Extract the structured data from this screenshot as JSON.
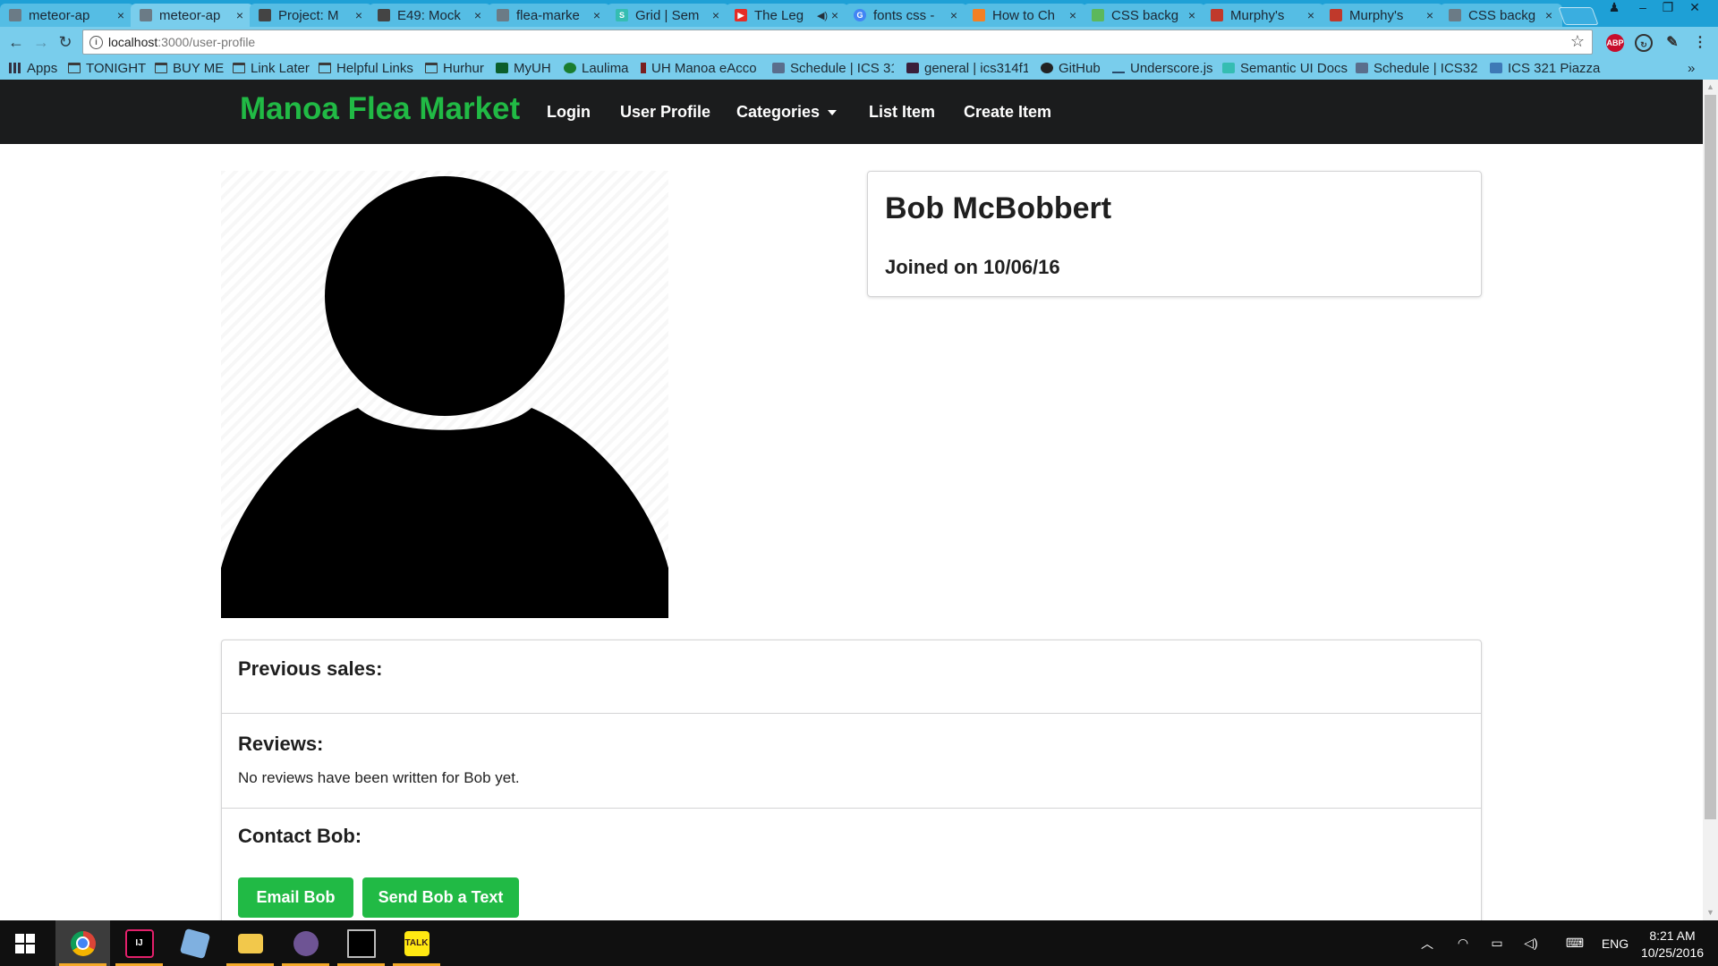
{
  "browser": {
    "tabs": [
      {
        "title": "meteor-ap",
        "favicon": "page-icon",
        "color": "#6b7b86",
        "active": false
      },
      {
        "title": "meteor-ap",
        "favicon": "page-icon",
        "color": "#6b7b86",
        "active": true
      },
      {
        "title": "Project: M",
        "favicon": "github-icon",
        "color": "#444444",
        "active": false
      },
      {
        "title": "E49: Mock",
        "favicon": "github-icon",
        "color": "#444444",
        "active": false
      },
      {
        "title": "flea-marke",
        "favicon": "page-icon",
        "color": "#6b7b86",
        "active": false
      },
      {
        "title": "Grid | Sem",
        "favicon": "semantic-ui-icon",
        "color": "#35bdb2",
        "active": false
      },
      {
        "title": "The Leg",
        "favicon": "youtube-icon",
        "color": "#e52d27",
        "active": false,
        "audio": true
      },
      {
        "title": "fonts css -",
        "favicon": "google-icon",
        "color": "#4285f4",
        "active": false
      },
      {
        "title": "How to Ch",
        "favicon": "stackoverflow-icon",
        "color": "#f48024",
        "active": false
      },
      {
        "title": "CSS backg",
        "favicon": "w3schools-icon",
        "color": "#5cb85c",
        "active": false
      },
      {
        "title": "Murphy's",
        "favicon": "murphys-icon",
        "color": "#c0392b",
        "active": false
      },
      {
        "title": "Murphy's",
        "favicon": "murphys-icon",
        "color": "#c0392b",
        "active": false
      },
      {
        "title": "CSS backg",
        "favicon": "page-icon",
        "color": "#6b7b86",
        "active": false
      }
    ],
    "url_host": "localhost",
    "url_path": ":3000/user-profile",
    "bookmarks": [
      {
        "label": "Apps",
        "icon": "apps-grid-icon"
      },
      {
        "label": "TONIGHT",
        "icon": "folder-icon"
      },
      {
        "label": "BUY ME",
        "icon": "folder-icon"
      },
      {
        "label": "Link Later",
        "icon": "folder-icon"
      },
      {
        "label": "Helpful Links",
        "icon": "folder-icon"
      },
      {
        "label": "Hurhur",
        "icon": "folder-icon"
      },
      {
        "label": "MyUH",
        "icon": "myuh-icon"
      },
      {
        "label": "Laulima",
        "icon": "laulima-icon"
      },
      {
        "label": "UH Manoa eAcco",
        "icon": "uh-icon"
      },
      {
        "label": "Schedule | ICS 31",
        "icon": "page-icon"
      },
      {
        "label": "general | ics314f1",
        "icon": "slack-icon"
      },
      {
        "label": "GitHub",
        "icon": "github-icon"
      },
      {
        "label": "Underscore.js",
        "icon": "underscore-icon"
      },
      {
        "label": "Semantic UI Docs",
        "icon": "semantic-ui-icon"
      },
      {
        "label": "Schedule | ICS32",
        "icon": "page-icon"
      },
      {
        "label": "ICS 321 Piazza",
        "icon": "piazza-icon"
      }
    ],
    "bookmarks_overflow": "»",
    "extensions": [
      {
        "name": "adblock-icon",
        "label": "ABP",
        "color": "#c70d2c"
      },
      {
        "name": "sync-icon",
        "label": "",
        "color": "#333333"
      },
      {
        "name": "eyedropper-icon",
        "label": "",
        "color": "#333333"
      }
    ]
  },
  "site": {
    "brand": "Manoa Flea Market",
    "nav": {
      "login": "Login",
      "user_profile": "User Profile",
      "categories": "Categories",
      "list_item": "List Item",
      "create_item": "Create Item"
    },
    "colors": {
      "brand": "#21ba45",
      "nav_bg": "#1b1c1d",
      "button": "#21ba45"
    }
  },
  "profile": {
    "name": "Bob McBobbert",
    "joined": "Joined on 10/06/16",
    "previous_sales_heading": "Previous sales:",
    "reviews_heading": "Reviews:",
    "reviews_text": "No reviews have been written for Bob yet.",
    "contact_heading": "Contact Bob:",
    "email_button": "Email Bob",
    "text_button": "Send Bob a Text"
  },
  "taskbar": {
    "apps": [
      {
        "name": "chrome-icon",
        "active": true
      },
      {
        "name": "intellij-icon",
        "active": false
      },
      {
        "name": "virtualbox-icon",
        "active": false
      },
      {
        "name": "file-explorer-icon",
        "active": false
      },
      {
        "name": "github-desktop-icon",
        "active": false
      },
      {
        "name": "terminal-icon",
        "active": false
      },
      {
        "name": "kakaotalk-icon",
        "active": false
      }
    ],
    "language": "ENG",
    "time": "8:21 AM",
    "date": "10/25/2016"
  }
}
